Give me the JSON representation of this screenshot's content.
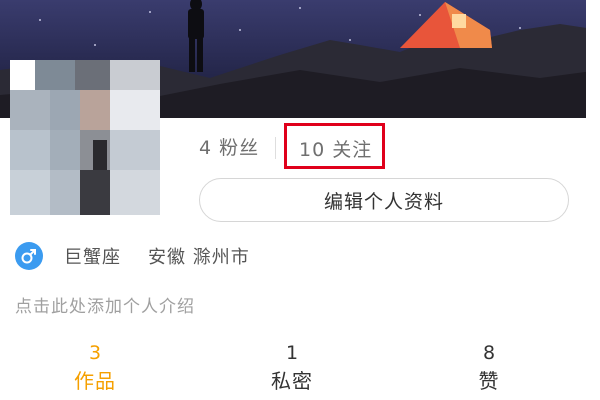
{
  "profile": {
    "fans_label": "4 粉丝",
    "following_label": "10 关注",
    "edit_button": "编辑个人资料",
    "gender_icon": "male-icon",
    "zodiac": "巨蟹座",
    "location": "安徽 滁州市",
    "bio_placeholder": "点击此处添加个人介绍"
  },
  "tabs": [
    {
      "count": "3",
      "label": "作品"
    },
    {
      "count": "1",
      "label": "私密"
    },
    {
      "count": "8",
      "label": "赞"
    }
  ],
  "colors": {
    "active_tab": "#f5a000",
    "highlight_box": "#e0001b",
    "gender_badge": "#3b9bf0"
  }
}
